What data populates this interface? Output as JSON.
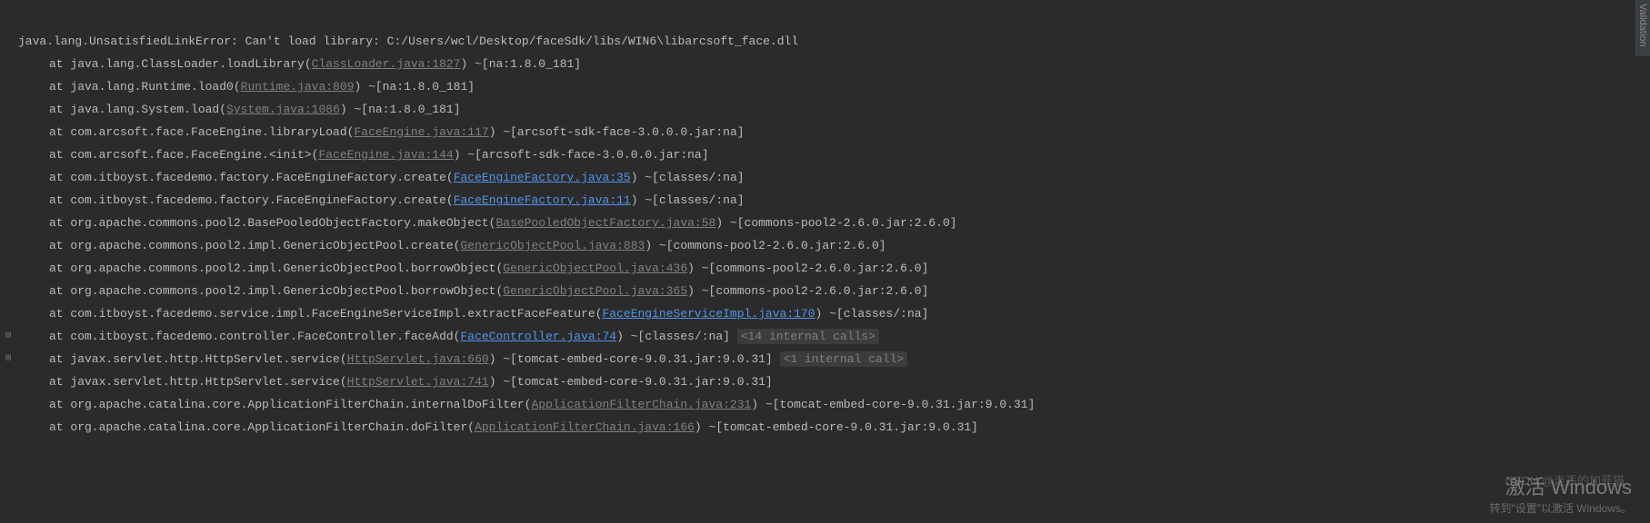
{
  "sidebar": {
    "validation": "Validation"
  },
  "error": {
    "head": "java.lang.UnsatisfiedLinkError: Can't load library: C:/Users/wcl/Desktop/faceSdk/libs/WIN6\\libarcsoft_face.dll"
  },
  "frames": [
    {
      "pre": "at java.lang.ClassLoader.loadLibrary(",
      "link": "ClassLoader.java:1827",
      "linkType": "grey",
      "post": ") ~[na:1.8.0_181]",
      "fold": false
    },
    {
      "pre": "at java.lang.Runtime.load0(",
      "link": "Runtime.java:809",
      "linkType": "grey",
      "post": ") ~[na:1.8.0_181]",
      "fold": false
    },
    {
      "pre": "at java.lang.System.load(",
      "link": "System.java:1086",
      "linkType": "grey",
      "post": ") ~[na:1.8.0_181]",
      "fold": false
    },
    {
      "pre": "at com.arcsoft.face.FaceEngine.libraryLoad(",
      "link": "FaceEngine.java:117",
      "linkType": "grey",
      "post": ") ~[arcsoft-sdk-face-3.0.0.0.jar:na]",
      "fold": false
    },
    {
      "pre": "at com.arcsoft.face.FaceEngine.<init>(",
      "link": "FaceEngine.java:144",
      "linkType": "grey",
      "post": ") ~[arcsoft-sdk-face-3.0.0.0.jar:na]",
      "fold": false
    },
    {
      "pre": "at com.itboyst.facedemo.factory.FaceEngineFactory.create(",
      "link": "FaceEngineFactory.java:35",
      "linkType": "blue",
      "post": ") ~[classes/:na]",
      "fold": false
    },
    {
      "pre": "at com.itboyst.facedemo.factory.FaceEngineFactory.create(",
      "link": "FaceEngineFactory.java:11",
      "linkType": "blue",
      "post": ") ~[classes/:na]",
      "fold": false
    },
    {
      "pre": "at org.apache.commons.pool2.BasePooledObjectFactory.makeObject(",
      "link": "BasePooledObjectFactory.java:58",
      "linkType": "grey",
      "post": ") ~[commons-pool2-2.6.0.jar:2.6.0]",
      "fold": false
    },
    {
      "pre": "at org.apache.commons.pool2.impl.GenericObjectPool.create(",
      "link": "GenericObjectPool.java:883",
      "linkType": "grey",
      "post": ") ~[commons-pool2-2.6.0.jar:2.6.0]",
      "fold": false
    },
    {
      "pre": "at org.apache.commons.pool2.impl.GenericObjectPool.borrowObject(",
      "link": "GenericObjectPool.java:436",
      "linkType": "grey",
      "post": ") ~[commons-pool2-2.6.0.jar:2.6.0]",
      "fold": false
    },
    {
      "pre": "at org.apache.commons.pool2.impl.GenericObjectPool.borrowObject(",
      "link": "GenericObjectPool.java:365",
      "linkType": "grey",
      "post": ") ~[commons-pool2-2.6.0.jar:2.6.0]",
      "fold": false
    },
    {
      "pre": "at com.itboyst.facedemo.service.impl.FaceEngineServiceImpl.extractFaceFeature(",
      "link": "FaceEngineServiceImpl.java:170",
      "linkType": "blue",
      "post": ") ~[classes/:na]",
      "fold": false
    },
    {
      "pre": "at com.itboyst.facedemo.controller.FaceController.faceAdd(",
      "link": "FaceController.java:74",
      "linkType": "blue",
      "post": ") ~[classes/:na]",
      "fold": true,
      "foldText": "<14 internal calls>"
    },
    {
      "pre": "at javax.servlet.http.HttpServlet.service(",
      "link": "HttpServlet.java:660",
      "linkType": "grey",
      "post": ") ~[tomcat-embed-core-9.0.31.jar:9.0.31]",
      "fold": true,
      "foldText": "<1 internal call>"
    },
    {
      "pre": "at javax.servlet.http.HttpServlet.service(",
      "link": "HttpServlet.java:741",
      "linkType": "grey",
      "post": ") ~[tomcat-embed-core-9.0.31.jar:9.0.31]",
      "fold": false
    },
    {
      "pre": "at org.apache.catalina.core.ApplicationFilterChain.internalDoFilter(",
      "link": "ApplicationFilterChain.java:231",
      "linkType": "grey",
      "post": ") ~[tomcat-embed-core-9.0.31.jar:9.0.31]",
      "fold": false
    },
    {
      "pre": "at org.apache.catalina.core.ApplicationFilterChain.doFilter(",
      "link": "ApplicationFilterChain.java:166",
      "linkType": "grey",
      "post": ") ~[tomcat-embed-core-9.0.31.jar:9.0.31]",
      "fold": false
    }
  ],
  "watermark": {
    "csdn": "CSDN @走丢的加菲猫",
    "win_big": "激活 Windows",
    "win_small": "转到\"设置\"以激活 Windows。"
  }
}
